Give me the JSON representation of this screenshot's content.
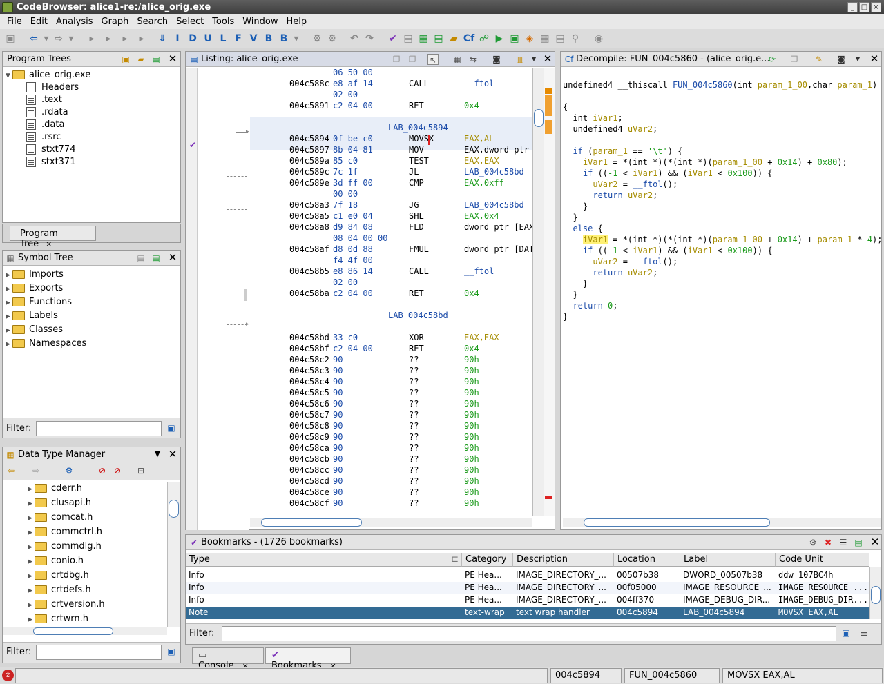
{
  "window": {
    "title": "CodeBrowser: alice1-re:/alice_orig.exe"
  },
  "menu": [
    "File",
    "Edit",
    "Analysis",
    "Graph",
    "Search",
    "Select",
    "Tools",
    "Window",
    "Help"
  ],
  "toolbar_icons": [
    "save-icon",
    "back-icon",
    "forward-icon",
    "I",
    "D",
    "U",
    "L",
    "F",
    "V",
    "B",
    "undo-icon",
    "redo-icon",
    "check-icon"
  ],
  "program_trees": {
    "title": "Program Trees",
    "root": "alice_orig.exe",
    "items": [
      "Headers",
      ".text",
      ".rdata",
      ".data",
      ".rsrc",
      "stxt774",
      "stxt371"
    ],
    "tab": "Program Tree"
  },
  "symbol_tree": {
    "title": "Symbol Tree",
    "items": [
      "Imports",
      "Exports",
      "Functions",
      "Labels",
      "Classes",
      "Namespaces"
    ],
    "filter_label": "Filter:"
  },
  "data_type_manager": {
    "title": "Data Type Manager",
    "items": [
      "cderr.h",
      "clusapi.h",
      "comcat.h",
      "commctrl.h",
      "commdlg.h",
      "conio.h",
      "crtdbg.h",
      "crtdefs.h",
      "crtversion.h",
      "crtwrn.h"
    ],
    "filter_label": "Filter:"
  },
  "listing": {
    "title": "Listing:  alice_orig.exe",
    "rows": [
      {
        "bytes": "06 50 00"
      },
      {
        "addr": "004c588c",
        "bytes": "e8 af 14",
        "mnem": "CALL",
        "oper": "__ftol",
        "oc": "blu"
      },
      {
        "bytes": "02 00"
      },
      {
        "addr": "004c5891",
        "bytes": "c2 04 00",
        "mnem": "RET",
        "oper": "0x4",
        "oc": "grn"
      },
      {},
      {
        "label": "LAB_004c5894"
      },
      {
        "addr": "004c5894",
        "bytes": "0f be c0",
        "mnem": "MOVSX",
        "oper": "EAX,AL",
        "oc": "reg"
      },
      {
        "addr": "004c5897",
        "bytes": "8b 04 81",
        "mnem": "MOV",
        "oper": "EAX,dword ptr",
        "oc": ""
      },
      {
        "addr": "004c589a",
        "bytes": "85 c0",
        "mnem": "TEST",
        "oper": "EAX,EAX",
        "oc": "reg"
      },
      {
        "addr": "004c589c",
        "bytes": "7c 1f",
        "mnem": "JL",
        "oper": "LAB_004c58bd",
        "oc": "blu"
      },
      {
        "addr": "004c589e",
        "bytes": "3d ff 00",
        "mnem": "CMP",
        "oper": "EAX,0xff",
        "oc": "grn"
      },
      {
        "bytes": "00 00"
      },
      {
        "addr": "004c58a3",
        "bytes": "7f 18",
        "mnem": "JG",
        "oper": "LAB_004c58bd",
        "oc": "blu"
      },
      {
        "addr": "004c58a5",
        "bytes": "c1 e0 04",
        "mnem": "SHL",
        "oper": "EAX,0x4",
        "oc": "grn"
      },
      {
        "addr": "004c58a8",
        "bytes": "d9 84 08",
        "mnem": "FLD",
        "oper": "dword ptr [EAX",
        "oc": ""
      },
      {
        "bytes": "08 04 00 00"
      },
      {
        "addr": "004c58af",
        "bytes": "d8 0d 88",
        "mnem": "FMUL",
        "oper": "dword ptr [DAT",
        "oc": ""
      },
      {
        "bytes": "f4 4f 00"
      },
      {
        "addr": "004c58b5",
        "bytes": "e8 86 14",
        "mnem": "CALL",
        "oper": "__ftol",
        "oc": "blu"
      },
      {
        "bytes": "02 00"
      },
      {
        "addr": "004c58ba",
        "bytes": "c2 04 00",
        "mnem": "RET",
        "oper": "0x4",
        "oc": "grn"
      },
      {},
      {
        "label": "LAB_004c58bd"
      },
      {},
      {
        "addr": "004c58bd",
        "bytes": "33 c0",
        "mnem": "XOR",
        "oper": "EAX,EAX",
        "oc": "reg"
      },
      {
        "addr": "004c58bf",
        "bytes": "c2 04 00",
        "mnem": "RET",
        "oper": "0x4",
        "oc": "grn"
      },
      {
        "addr": "004c58c2",
        "bytes": "90",
        "mnem": "??",
        "oper": "90h",
        "oc": "grn"
      },
      {
        "addr": "004c58c3",
        "bytes": "90",
        "mnem": "??",
        "oper": "90h",
        "oc": "grn"
      },
      {
        "addr": "004c58c4",
        "bytes": "90",
        "mnem": "??",
        "oper": "90h",
        "oc": "grn"
      },
      {
        "addr": "004c58c5",
        "bytes": "90",
        "mnem": "??",
        "oper": "90h",
        "oc": "grn"
      },
      {
        "addr": "004c58c6",
        "bytes": "90",
        "mnem": "??",
        "oper": "90h",
        "oc": "grn"
      },
      {
        "addr": "004c58c7",
        "bytes": "90",
        "mnem": "??",
        "oper": "90h",
        "oc": "grn"
      },
      {
        "addr": "004c58c8",
        "bytes": "90",
        "mnem": "??",
        "oper": "90h",
        "oc": "grn"
      },
      {
        "addr": "004c58c9",
        "bytes": "90",
        "mnem": "??",
        "oper": "90h",
        "oc": "grn"
      },
      {
        "addr": "004c58ca",
        "bytes": "90",
        "mnem": "??",
        "oper": "90h",
        "oc": "grn"
      },
      {
        "addr": "004c58cb",
        "bytes": "90",
        "mnem": "??",
        "oper": "90h",
        "oc": "grn"
      },
      {
        "addr": "004c58cc",
        "bytes": "90",
        "mnem": "??",
        "oper": "90h",
        "oc": "grn"
      },
      {
        "addr": "004c58cd",
        "bytes": "90",
        "mnem": "??",
        "oper": "90h",
        "oc": "grn"
      },
      {
        "addr": "004c58ce",
        "bytes": "90",
        "mnem": "??",
        "oper": "90h",
        "oc": "grn"
      },
      {
        "addr": "004c58cf",
        "bytes": "90",
        "mnem": "??",
        "oper": "90h",
        "oc": "grn"
      }
    ]
  },
  "decompile": {
    "title": "Decompile: FUN_004c5860 -  (alice_orig.e...",
    "lines": [
      [
        [
          "t",
          "undefined4 __thiscall "
        ],
        [
          "fn",
          "FUN_004c5860"
        ],
        [
          "t",
          "(int "
        ],
        [
          "var",
          "param_1_00"
        ],
        [
          "t",
          ",char "
        ],
        [
          "var",
          "param_1"
        ],
        [
          "t",
          ")"
        ]
      ],
      [],
      [
        [
          "t",
          "{"
        ]
      ],
      [
        [
          "t",
          "  int "
        ],
        [
          "var",
          "iVar1"
        ],
        [
          "t",
          ";"
        ]
      ],
      [
        [
          "t",
          "  undefined4 "
        ],
        [
          "var",
          "uVar2"
        ],
        [
          "t",
          ";"
        ]
      ],
      [],
      [
        [
          "t",
          "  "
        ],
        [
          "kw",
          "if"
        ],
        [
          "t",
          " ("
        ],
        [
          "var",
          "param_1"
        ],
        [
          "t",
          " == "
        ],
        [
          "str",
          "'\\t'"
        ],
        [
          "t",
          ") {"
        ]
      ],
      [
        [
          "t",
          "    "
        ],
        [
          "var",
          "iVar1"
        ],
        [
          "t",
          " = *(int *)(*(int *)("
        ],
        [
          "var",
          "param_1_00"
        ],
        [
          "t",
          " + "
        ],
        [
          "num",
          "0x14"
        ],
        [
          "t",
          ") + "
        ],
        [
          "num",
          "0x80"
        ],
        [
          "t",
          ");"
        ]
      ],
      [
        [
          "t",
          "    "
        ],
        [
          "kw",
          "if"
        ],
        [
          "t",
          " (("
        ],
        [
          "num",
          "-1"
        ],
        [
          "t",
          " < "
        ],
        [
          "var",
          "iVar1"
        ],
        [
          "t",
          ") && ("
        ],
        [
          "var",
          "iVar1"
        ],
        [
          "t",
          " < "
        ],
        [
          "num",
          "0x100"
        ],
        [
          "t",
          ")) {"
        ]
      ],
      [
        [
          "t",
          "      "
        ],
        [
          "var",
          "uVar2"
        ],
        [
          "t",
          " = "
        ],
        [
          "fn",
          "__ftol"
        ],
        [
          "t",
          "();"
        ]
      ],
      [
        [
          "t",
          "      "
        ],
        [
          "kw",
          "return"
        ],
        [
          "t",
          " "
        ],
        [
          "var",
          "uVar2"
        ],
        [
          "t",
          ";"
        ]
      ],
      [
        [
          "t",
          "    }"
        ]
      ],
      [
        [
          "t",
          "  }"
        ]
      ],
      [
        [
          "t",
          "  "
        ],
        [
          "kw",
          "else"
        ],
        [
          "t",
          " {"
        ]
      ],
      [
        [
          "t",
          "    "
        ],
        [
          "hl",
          "iVar1"
        ],
        [
          "t",
          " = *(int *)(*(int *)("
        ],
        [
          "var",
          "param_1_00"
        ],
        [
          "t",
          " + "
        ],
        [
          "num",
          "0x14"
        ],
        [
          "t",
          ") + "
        ],
        [
          "var",
          "param_1"
        ],
        [
          "t",
          " * "
        ],
        [
          "num",
          "4"
        ],
        [
          "t",
          ");"
        ]
      ],
      [
        [
          "t",
          "    "
        ],
        [
          "kw",
          "if"
        ],
        [
          "t",
          " (("
        ],
        [
          "num",
          "-1"
        ],
        [
          "t",
          " < "
        ],
        [
          "var",
          "iVar1"
        ],
        [
          "t",
          ") && ("
        ],
        [
          "var",
          "iVar1"
        ],
        [
          "t",
          " < "
        ],
        [
          "num",
          "0x100"
        ],
        [
          "t",
          ")) {"
        ]
      ],
      [
        [
          "t",
          "      "
        ],
        [
          "var",
          "uVar2"
        ],
        [
          "t",
          " = "
        ],
        [
          "fn",
          "__ftol"
        ],
        [
          "t",
          "();"
        ]
      ],
      [
        [
          "t",
          "      "
        ],
        [
          "kw",
          "return"
        ],
        [
          "t",
          " "
        ],
        [
          "var",
          "uVar2"
        ],
        [
          "t",
          ";"
        ]
      ],
      [
        [
          "t",
          "    }"
        ]
      ],
      [
        [
          "t",
          "  }"
        ]
      ],
      [
        [
          "t",
          "  "
        ],
        [
          "kw",
          "return"
        ],
        [
          "t",
          " "
        ],
        [
          "num",
          "0"
        ],
        [
          "t",
          ";"
        ]
      ],
      [
        [
          "t",
          "}"
        ]
      ]
    ]
  },
  "bookmarks": {
    "title": "Bookmarks - (1726 bookmarks)",
    "columns": [
      "Type",
      "Category",
      "Description",
      "Location",
      "Label",
      "Code Unit"
    ],
    "rows": [
      [
        "Info",
        "PE Hea...",
        "IMAGE_DIRECTORY_...",
        "00507b38",
        "DWORD_00507b38",
        "ddw 107BC4h"
      ],
      [
        "Info",
        "PE Hea...",
        "IMAGE_DIRECTORY_...",
        "00f05000",
        "IMAGE_RESOURCE_...",
        "IMAGE_RESOURCE_..."
      ],
      [
        "Info",
        "PE Hea...",
        "IMAGE_DIRECTORY_...",
        "004ff370",
        "IMAGE_DEBUG_DIR...",
        "IMAGE_DEBUG_DIR..."
      ],
      [
        "Note",
        "text-wrap",
        "text wrap handler",
        "004c5894",
        "LAB_004c5894",
        "MOVSX EAX,AL"
      ]
    ],
    "filter_label": "Filter:"
  },
  "bottom_tabs": [
    "Console",
    "Bookmarks"
  ],
  "status": {
    "address": "004c5894",
    "function": "FUN_004c5860",
    "instruction": "MOVSX EAX,AL"
  }
}
